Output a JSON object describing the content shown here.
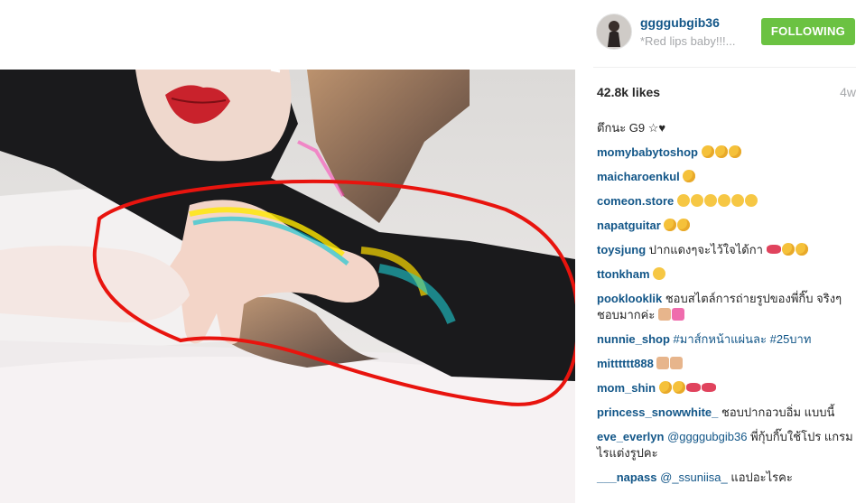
{
  "post": {
    "username": "ggggubgib36",
    "caption_preview": "*Red lips baby!!!...",
    "follow_label": "FOLLOWING",
    "likes": "42.8k likes",
    "age": "4w",
    "caption_text": "ตึกนะ G9 ☆♥"
  },
  "comments": [
    {
      "user": "momybabytoshop",
      "text": "",
      "emojis": [
        "kiss",
        "kiss",
        "kiss"
      ]
    },
    {
      "user": "maicharoenkul",
      "text": "",
      "emojis": [
        "kiss"
      ]
    },
    {
      "user": "comeon.store",
      "text": "",
      "emojis": [
        "grin",
        "grin",
        "grin",
        "grin",
        "grin",
        "grin"
      ]
    },
    {
      "user": "napatguitar",
      "text": "",
      "emojis": [
        "kiss",
        "kiss"
      ]
    },
    {
      "user": "toysjung",
      "text": "ปากแดงๆจะไว้ใจได้กา",
      "emojis": [
        "lips",
        "kiss",
        "kiss"
      ]
    },
    {
      "user": "ttonkham",
      "text": "",
      "emojis": [
        "grin"
      ]
    },
    {
      "user": "pooklooklik",
      "text": "ชอบสไตล์การถ่ายรูปของพี่กิ๊บ จริงๆ ชอบมากค่ะ",
      "emojis": [
        "thumb",
        "heart"
      ]
    },
    {
      "user": "nunnie_shop",
      "text": "",
      "mention": "#มาส์กหน้าแผ่นละ #25บาท",
      "emojis": []
    },
    {
      "user": "mitttttt888",
      "text": "",
      "emojis": [
        "thumb",
        "thumb"
      ]
    },
    {
      "user": "mom_shin",
      "text": "",
      "emojis": [
        "kiss",
        "kiss",
        "lips",
        "lips"
      ]
    },
    {
      "user": "princess_snowwhite_",
      "text": "ชอบปากอวบอิ่ม แบบนี้",
      "emojis": []
    },
    {
      "user": "eve_everlyn",
      "mention": "@ggggubgib36",
      "text": "พี่กุ้บกิ๊บใช้โปร แกรมไรแต่งรูปคะ",
      "emojis": []
    },
    {
      "user": "___napass",
      "mention": "@_ssuniisa_",
      "text": "แอปอะไรคะ",
      "emojis": []
    }
  ],
  "colors": {
    "username": "#125688",
    "follow_button": "#6bc242",
    "muted": "#a5a7aa",
    "annotation_circle": "#e8140e"
  }
}
